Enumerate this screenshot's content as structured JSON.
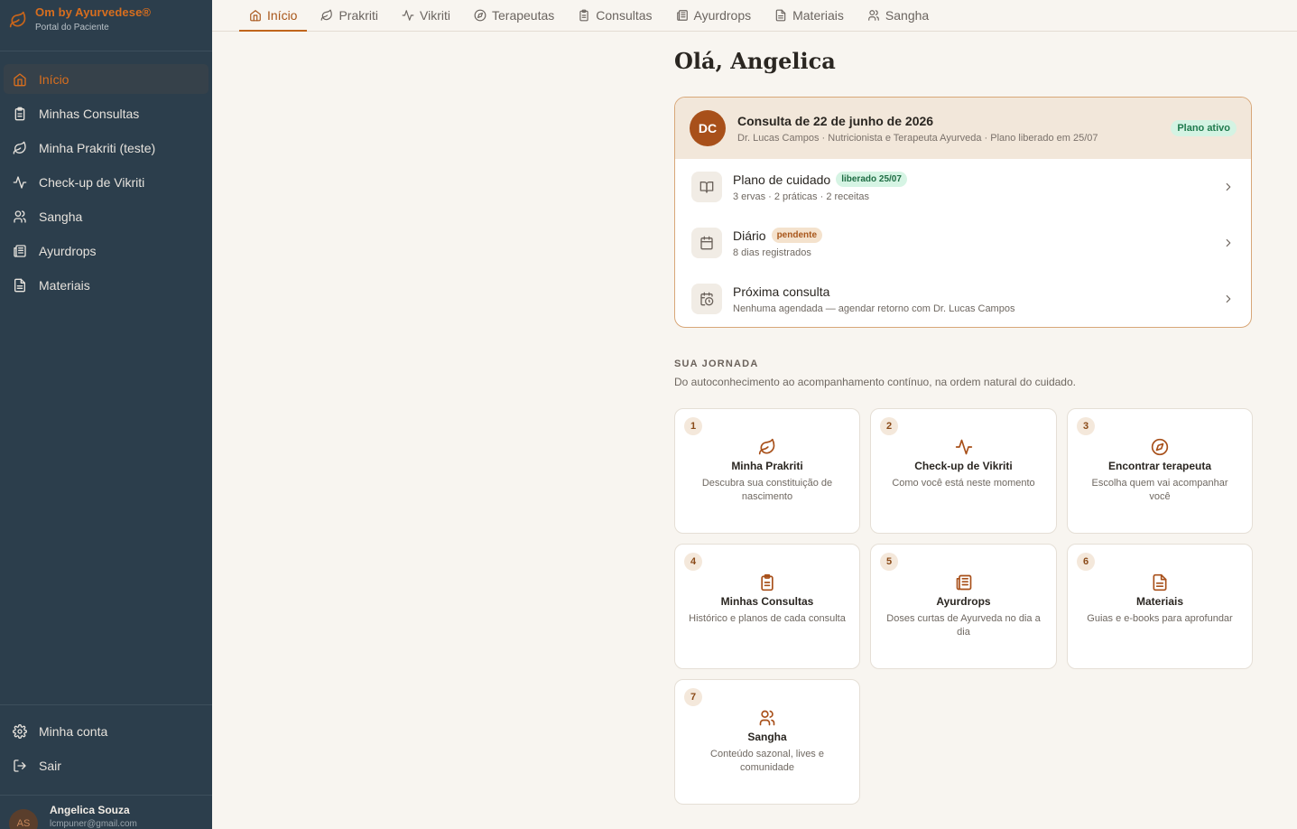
{
  "brand": {
    "title": "Om by Ayurvedese®",
    "subtitle": "Portal do Paciente",
    "icon": "leaf-icon"
  },
  "sidebar": {
    "items": [
      {
        "label": "Início",
        "icon": "home-icon",
        "active": true
      },
      {
        "label": "Minhas Consultas",
        "icon": "clipboard-icon"
      },
      {
        "label": "Minha Prakriti (teste)",
        "icon": "leaf-icon"
      },
      {
        "label": "Check-up de Vikriti",
        "icon": "pulse-icon"
      },
      {
        "label": "Sangha",
        "icon": "users-icon"
      },
      {
        "label": "Ayurdrops",
        "icon": "newspaper-icon"
      },
      {
        "label": "Materiais",
        "icon": "document-icon"
      }
    ],
    "bottom": [
      {
        "label": "Minha conta",
        "icon": "gear-icon"
      },
      {
        "label": "Sair",
        "icon": "logout-icon"
      }
    ]
  },
  "user": {
    "initials": "AS",
    "name": "Angelica Souza",
    "email": "lcmpuner@gmail.com"
  },
  "tabs": [
    {
      "label": "Início",
      "icon": "home-icon",
      "active": true
    },
    {
      "label": "Prakriti",
      "icon": "leaf-icon"
    },
    {
      "label": "Vikriti",
      "icon": "pulse-icon"
    },
    {
      "label": "Terapeutas",
      "icon": "compass-icon"
    },
    {
      "label": "Consultas",
      "icon": "clipboard-icon"
    },
    {
      "label": "Ayurdrops",
      "icon": "newspaper-icon"
    },
    {
      "label": "Materiais",
      "icon": "document-icon"
    },
    {
      "label": "Sangha",
      "icon": "users-icon"
    }
  ],
  "main": {
    "greeting": "Olá, Angelica",
    "consult": {
      "initials": "DC",
      "title": "Consulta de 22 de junho de 2026",
      "subtitle": "Dr. Lucas Campos · Nutricionista e Terapeuta Ayurveda · Plano liberado em 25/07",
      "badge": "Plano ativo",
      "rows": [
        {
          "title": "Plano de cuidado",
          "pill": "liberado 25/07",
          "sub": "3 ervas · 2 práticas · 2 receitas",
          "icon": "book-icon"
        },
        {
          "title": "Diário",
          "pill": "pendente",
          "sub": "8 dias registrados",
          "icon": "calendar-icon"
        },
        {
          "title": "Próxima consulta",
          "pill": "",
          "sub": "Nenhuma agendada — agendar retorno com Dr. Lucas Campos",
          "icon": "calendar-clock-icon"
        }
      ]
    },
    "journey": {
      "label": "SUA JORNADA",
      "subtitle": "Do autoconhecimento ao acompanhamento contínuo, na ordem natural do cuidado.",
      "cards": [
        {
          "num": "1",
          "title": "Minha Prakriti",
          "desc": "Descubra sua constituição de nascimento",
          "icon": "leaf-icon"
        },
        {
          "num": "2",
          "title": "Check-up de Vikriti",
          "desc": "Como você está neste momento",
          "icon": "pulse-icon"
        },
        {
          "num": "3",
          "title": "Encontrar terapeuta",
          "desc": "Escolha quem vai acompanhar você",
          "icon": "compass-icon"
        },
        {
          "num": "4",
          "title": "Minhas Consultas",
          "desc": "Histórico e planos de cada consulta",
          "icon": "clipboard-icon"
        },
        {
          "num": "5",
          "title": "Ayurdrops",
          "desc": "Doses curtas de Ayurveda no dia a dia",
          "icon": "newspaper-icon"
        },
        {
          "num": "6",
          "title": "Materiais",
          "desc": "Guias e e-books para aprofundar",
          "icon": "document-icon"
        },
        {
          "num": "7",
          "title": "Sangha",
          "desc": "Conteúdo sazonal, lives e comunidade",
          "icon": "users-icon"
        }
      ]
    }
  },
  "colors": {
    "accent": "#c0651c",
    "sidebar": "#2c3e4c",
    "background": "#f8f5f0",
    "success": "#1f7a4d"
  }
}
